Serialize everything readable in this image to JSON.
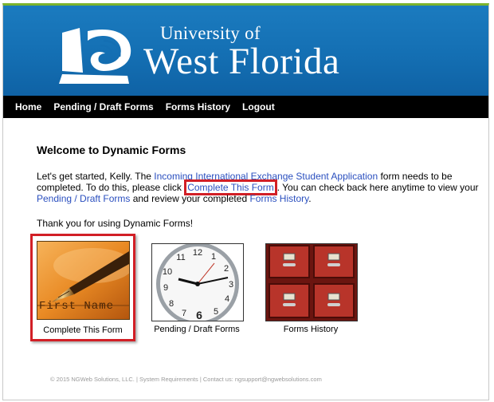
{
  "header": {
    "logo_line1": "University of",
    "logo_line2": "West Florida",
    "colors": {
      "header_blue": "#146fb3",
      "top_accent": "#7bb32e",
      "nav_bg": "#000000"
    }
  },
  "nav": {
    "items": [
      {
        "label": "Home"
      },
      {
        "label": "Pending / Draft Forms"
      },
      {
        "label": "Forms History"
      },
      {
        "label": "Logout"
      }
    ]
  },
  "main": {
    "title": "Welcome to Dynamic Forms",
    "intro": {
      "part1": "Let's get started, Kelly. The ",
      "form_link": "Incoming International Exchange Student Application",
      "part2": " form needs to be completed. To do this, please click ",
      "complete_link": "Complete This Form",
      "part3": ". You can check back here anytime to view your ",
      "pending_link": "Pending / Draft Forms",
      "part4": " and review your completed ",
      "history_link": "Forms History",
      "part5": "."
    },
    "thanks": "Thank you for using Dynamic Forms!",
    "tiles": [
      {
        "label": "Complete This Form",
        "icon": "fountain-pen-icon",
        "image_text": "First Name"
      },
      {
        "label": "Pending / Draft Forms",
        "icon": "clock-icon"
      },
      {
        "label": "Forms History",
        "icon": "file-cabinet-icon"
      }
    ],
    "highlight_color": "#d21f26",
    "link_color": "#2a4fbf"
  },
  "footer": {
    "text": "© 2015 NGWeb Solutions, LLC. | System Requirements | Contact us: ngsupport@ngwebsolutions.com"
  }
}
